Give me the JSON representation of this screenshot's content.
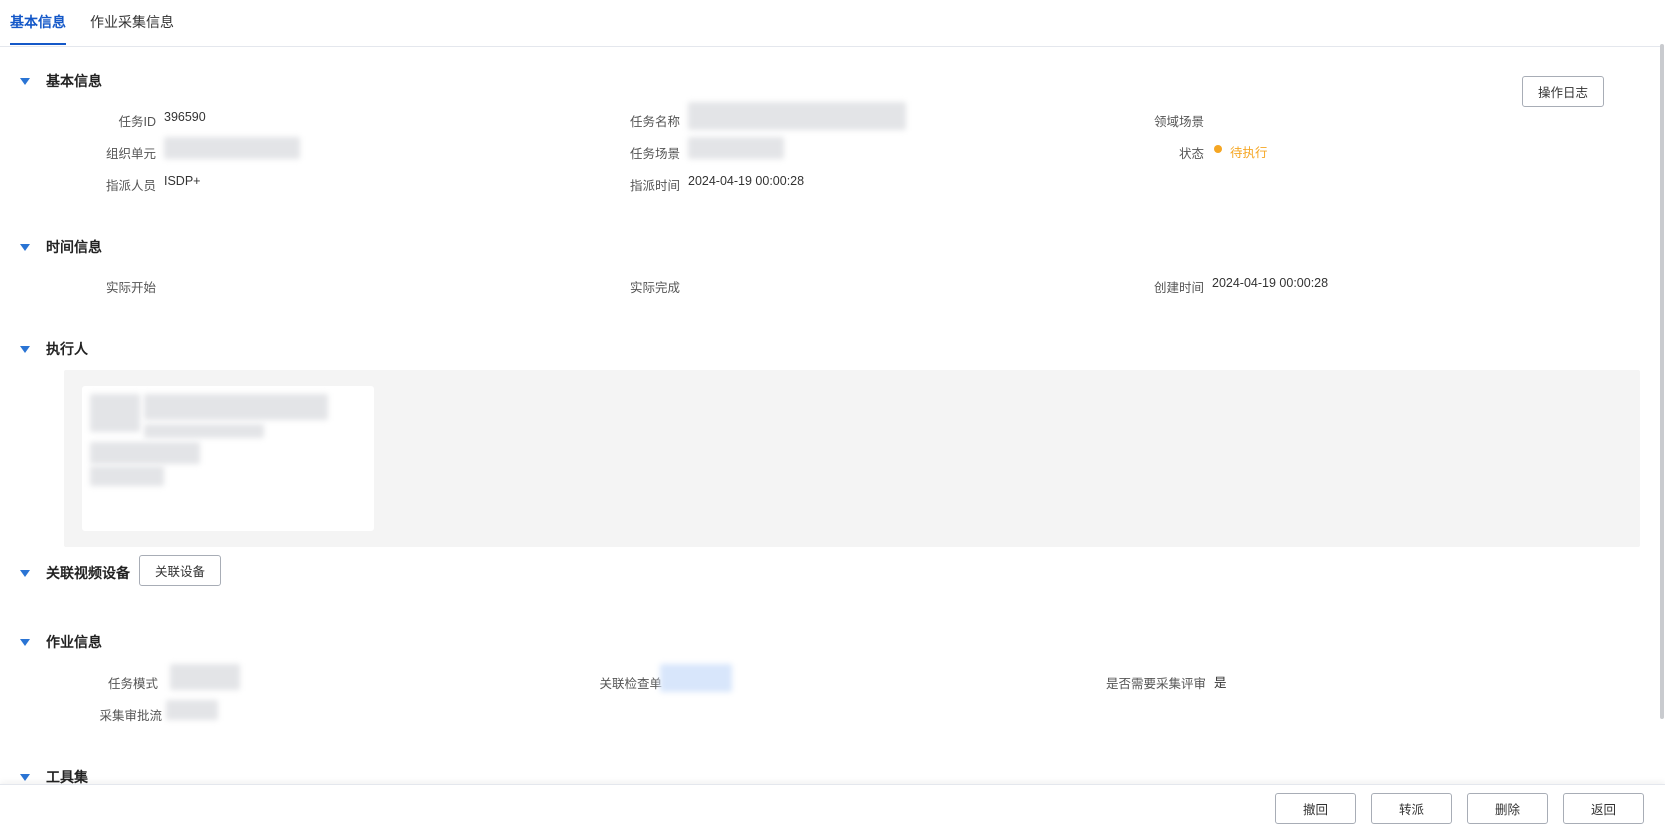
{
  "tabs": [
    {
      "label": "基本信息",
      "active": true
    },
    {
      "label": "作业采集信息",
      "active": false
    }
  ],
  "basic": {
    "title": "基本信息",
    "log_button": "操作日志",
    "task_id_label": "任务ID",
    "task_id_value": "396590",
    "task_name_label": "任务名称",
    "domain_scene_label": "领域场景",
    "org_unit_label": "组织单元",
    "task_scene_label": "任务场景",
    "status_label": "状态",
    "status_value": "待执行",
    "status_color": "#f5a623",
    "assigner_label": "指派人员",
    "assigner_value": "ISDP+",
    "assign_time_label": "指派时间",
    "assign_time_value": "2024-04-19 00:00:28"
  },
  "time": {
    "title": "时间信息",
    "actual_start_label": "实际开始",
    "actual_finish_label": "实际完成",
    "created_label": "创建时间",
    "created_value": "2024-04-19 00:00:28"
  },
  "executor": {
    "title": "执行人"
  },
  "video": {
    "title": "关联视频设备",
    "link_button": "关联设备"
  },
  "work": {
    "title": "作业信息",
    "task_mode_label": "任务模式",
    "checklist_label": "关联检查单",
    "review_label": "是否需要采集评审",
    "review_value": "是",
    "flow_label": "采集审批流"
  },
  "tools": {
    "title": "工具集"
  },
  "footer": {
    "revoke": "撤回",
    "transfer": "转派",
    "delete": "删除",
    "back": "返回"
  },
  "colors": {
    "primary": "#1458c8",
    "caret": "#2a74d4"
  }
}
